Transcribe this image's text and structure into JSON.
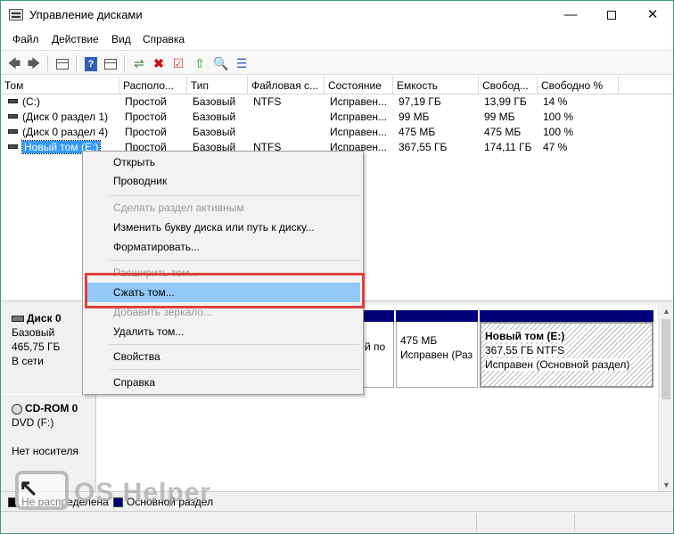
{
  "window": {
    "title": "Управление дисками",
    "controls": {
      "minimize": "—",
      "close": "✕"
    }
  },
  "menu": [
    "Файл",
    "Действие",
    "Вид",
    "Справка"
  ],
  "toolbar": {
    "back": "🡄",
    "forward": "🡆",
    "help": "?",
    "cancel": "✖",
    "check": "☑",
    "up": "⇧",
    "search": "🔍",
    "props": "☰"
  },
  "table": {
    "columns": [
      "Том",
      "Располо...",
      "Тип",
      "Файловая с...",
      "Состояние",
      "Емкость",
      "Свобод...",
      "Свободно %"
    ],
    "rows": [
      [
        "(C:)",
        "Простой",
        "Базовый",
        "NTFS",
        "Исправен...",
        "97,19 ГБ",
        "13,99 ГБ",
        "14 %"
      ],
      [
        "(Диск 0 раздел 1)",
        "Простой",
        "Базовый",
        "",
        "Исправен...",
        "99 МБ",
        "99 МБ",
        "100 %"
      ],
      [
        "(Диск 0 раздел 4)",
        "Простой",
        "Базовый",
        "",
        "Исправен...",
        "475 МБ",
        "475 МБ",
        "100 %"
      ],
      [
        "Новый том (E:)",
        "Простой",
        "Базовый",
        "NTFS",
        "Исправен...",
        "367,55 ГБ",
        "174,11 ГБ",
        "47 %"
      ]
    ]
  },
  "disks": [
    {
      "name": "Диск 0",
      "type": "Базовый",
      "size": "465,75 ГБ",
      "status": "В сети"
    },
    {
      "name": "CD-ROM 0",
      "type": "DVD (F:)",
      "size": "",
      "status": "Нет носителя"
    }
  ],
  "partitions": {
    "p_left_fragment": "й по",
    "p_475_size": "475 МБ",
    "p_475_status": "Исправен (Раз",
    "e_title": "Новый том  (E:)",
    "e_size": "367,55 ГБ NTFS",
    "e_status": "Исправен (Основной раздел)"
  },
  "legend": {
    "unallocated": "Не распределена",
    "primary": "Основной раздел",
    "colors": {
      "unallocated": "#000000",
      "primary": "#00007a"
    }
  },
  "context_menu": {
    "items": [
      {
        "label": "Открыть",
        "state": "enabled"
      },
      {
        "label": "Проводник",
        "state": "enabled"
      },
      {
        "label": "Сделать раздел активным",
        "state": "disabled"
      },
      {
        "label": "Изменить букву диска или путь к диску...",
        "state": "enabled"
      },
      {
        "label": "Форматировать...",
        "state": "enabled"
      },
      {
        "label": "Расширить том...",
        "state": "disabled"
      },
      {
        "label": "Сжать том...",
        "state": "highlighted"
      },
      {
        "label": "Добавить зеркало...",
        "state": "disabled"
      },
      {
        "label": "Удалить том...",
        "state": "enabled"
      },
      {
        "label": "Свойства",
        "state": "enabled"
      },
      {
        "label": "Справка",
        "state": "enabled"
      }
    ]
  },
  "watermark": "OS Helper",
  "colors": {
    "highlight": "#91c9f7",
    "red_frame": "#e0403c",
    "selection": "#3399ff"
  }
}
